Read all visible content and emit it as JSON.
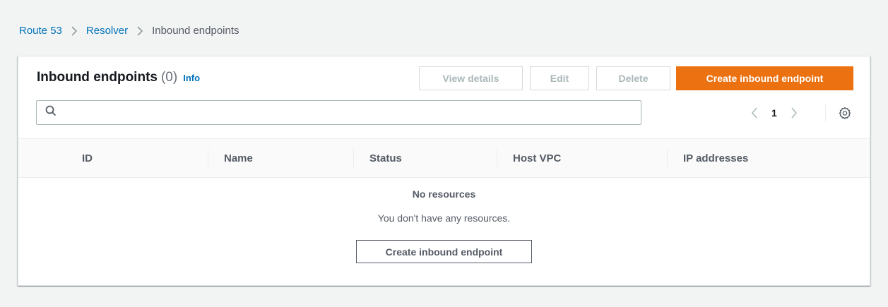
{
  "breadcrumb": {
    "items": [
      {
        "label": "Route 53"
      },
      {
        "label": "Resolver"
      }
    ],
    "current": "Inbound endpoints"
  },
  "panel": {
    "title": "Inbound endpoints",
    "count": "(0)",
    "info_label": "Info",
    "actions": {
      "view_details": "View details",
      "edit": "Edit",
      "delete": "Delete",
      "create": "Create inbound endpoint"
    },
    "disabled_actions": [
      "View details",
      "Edit",
      "Delete"
    ],
    "search": {
      "value": "",
      "placeholder": ""
    },
    "pagination": {
      "current_page": "1"
    },
    "icons": [
      "search-icon",
      "chevron-left-icon",
      "chevron-right-icon",
      "gear-icon",
      "chevron-right-separator-icon"
    ]
  },
  "table": {
    "columns": [
      "ID",
      "Name",
      "Status",
      "Host VPC",
      "IP addresses"
    ],
    "rows": []
  },
  "empty_state": {
    "title": "No resources",
    "description": "You don't have any resources.",
    "button_label": "Create inbound endpoint"
  },
  "colors": {
    "primary": "#ec7211",
    "link": "#0073bb",
    "background": "#f2f3f3",
    "disabled_text": "#aab7b8"
  }
}
